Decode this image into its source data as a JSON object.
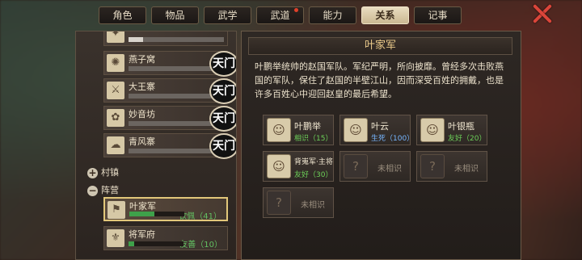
{
  "tabs": [
    {
      "label": "角色",
      "active": false,
      "dot": false
    },
    {
      "label": "物品",
      "active": false,
      "dot": false
    },
    {
      "label": "武学",
      "active": false,
      "dot": false
    },
    {
      "label": "武道",
      "active": false,
      "dot": true
    },
    {
      "label": "能力",
      "active": false,
      "dot": false
    },
    {
      "label": "关系",
      "active": true,
      "dot": false
    },
    {
      "label": "记事",
      "active": false,
      "dot": false
    }
  ],
  "sidebar": {
    "sects": [
      {
        "name": "",
        "emblem": "天门",
        "progress": 0.15
      },
      {
        "name": "燕子窝",
        "emblem": "天门",
        "progress": 0.0
      },
      {
        "name": "大王寨",
        "emblem": "天门",
        "progress": 0.0
      },
      {
        "name": "妙音坊",
        "emblem": "天门",
        "progress": 0.0
      },
      {
        "name": "青风寨",
        "emblem": "天门",
        "progress": 0.0
      }
    ],
    "categories": {
      "village": "村镇",
      "camp": "阵营",
      "village_sign": "+",
      "camp_sign": "−"
    },
    "camps": [
      {
        "name": "叶家军",
        "status": "钦佩（41）",
        "progress": 0.45,
        "selected": true
      },
      {
        "name": "将军府",
        "status": "友善（10）",
        "progress": 0.1,
        "selected": false
      }
    ]
  },
  "detail": {
    "title": "叶家军",
    "description": "叶鹏举统帅的赵国军队。军纪严明，所向披靡。曾经多次击败燕国的军队，保住了赵国的半壁江山，因而深受百姓的拥戴，也是许多百姓心中迎回赵皇的最后希望。",
    "members": [
      {
        "name": "叶鹏举",
        "status": "相识（15）",
        "status_color": "green",
        "known": true
      },
      {
        "name": "叶云",
        "status": "生死（100）",
        "status_color": "blue",
        "known": true
      },
      {
        "name": "叶银瓶",
        "status": "友好（20）",
        "status_color": "green",
        "known": true
      },
      {
        "name": "背嵬军·主将",
        "status": "友好（30）",
        "status_color": "green",
        "known": true
      },
      {
        "name": "未相识",
        "known": false
      },
      {
        "name": "未相识",
        "known": false
      },
      {
        "name": "未相识",
        "known": false
      }
    ]
  }
}
